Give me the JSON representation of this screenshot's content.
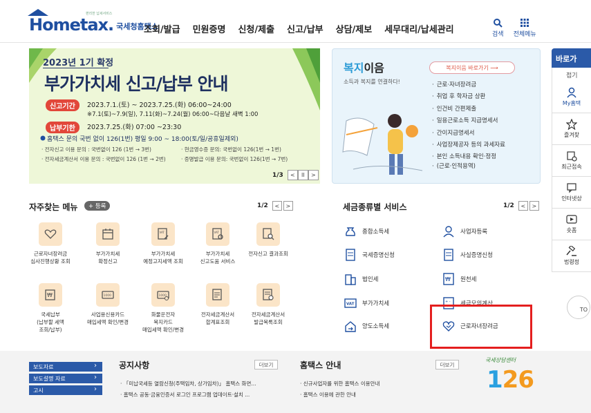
{
  "header": {
    "logo_main": "Hometax.",
    "logo_sub": "국세청홈택스",
    "logo_tiny": "편리한 납세서비스",
    "gnb": [
      "조회/발급",
      "민원증명",
      "신청/제출",
      "신고/납부",
      "상담/제보",
      "세무대리/납세관리"
    ],
    "search_label": "검색",
    "allmenu_label": "전체메뉴"
  },
  "banner": {
    "year": "2023년 1기 확정",
    "title": "부가가치세 신고/납부 안내",
    "period_label": "신고기간",
    "period_text": "2023.7.1.(토) ~ 2023.7.25.(화) 06:00~24:00",
    "period_note": "※7.1(토)~7.9(일), 7.11(화)~7.24(월) 06:00~다음날 새벽 1:00",
    "due_label": "납부기한",
    "due_text": "2023.7.25.(화) 07:00 ~23:30",
    "contact": "홈택스 문의 국번 없이 126(1번) 평일 9:00 ~ 18:00(토/일/공휴일제외)",
    "s1": "· 전자신고 이용 문의 : 국번없이 126 (1번 → 3번)",
    "s2": "· 현금영수증 문의: 국번없이 126(1번 → 1번)",
    "s3": "· 전자세금계산서 이용 문의 : 국번없이 126 (1번 → 2번)",
    "s4": "· 증명발급 이용 문의: 국번없이 126(1번 → 7번)",
    "page": "1/3",
    "prev": "<",
    "pause": "II",
    "next": ">"
  },
  "welfare": {
    "title_a": "복지",
    "title_b": "이음",
    "subtitle": "소득과 복지를 연결하다!",
    "button": "복지이음 바로가기",
    "items": [
      "근로·자녀장려금",
      "취업 후 학자금 상환",
      "인건비 간편제출",
      "일용근로소득 지급명세서",
      "간이지급명세서",
      "사업장제공자 등의 과세자료",
      "본인 소득내용 확인·정정",
      "(근로·인적용역)"
    ]
  },
  "quick": {
    "head": "바로가",
    "fold": "접기",
    "items": [
      "My홈택",
      "즐겨찾",
      "최근접속",
      "인터넷상",
      "숏폼",
      "법령정"
    ],
    "top": "TO"
  },
  "freq": {
    "title": "자주찾는 메뉴",
    "reg": "+ 등록",
    "page": "1/2",
    "prev": "<",
    "next": ">",
    "items": [
      "근로자녀장려금\n심사진행상황 조회",
      "부가가치세\n확정신고",
      "부가가치세\n예정고지세액 조회",
      "부가가치세\n신고도움 서비스",
      "전자신고 결과조회",
      "국세납부\n(납부할 세액\n조회/납부)",
      "사업용신용카드\n매입세액 확인/변경",
      "화물운전자\n복지카드\n매입세액 확인/변경",
      "전자세금계산서\n합계표조회",
      "전자세금계산서\n발급목록조회"
    ]
  },
  "tax": {
    "title": "세금종류별 서비스",
    "page": "1/2",
    "prev": "<",
    "next": ">",
    "items": [
      "종합소득세",
      "사업자등록",
      "국세증명신청",
      "사실증명신청",
      "법인세",
      "원천세",
      "부가가치세",
      "세금모의계산",
      "양도소득세",
      "근로자녀장려금"
    ]
  },
  "bottom": {
    "side": [
      "보도자료",
      "보도설명 자료",
      "고시"
    ],
    "notice_title": "공지사항",
    "notice_more": "더보기",
    "notice_lines": [
      "「미납국세등 열람신청(주택임차, 상가임차)」 홈택스 화면...",
      "홈택스 공동·금융인증서 로그인 프로그램 업데이트·설치 ..."
    ],
    "guide_title": "홈택스 안내",
    "guide_more": "더보기",
    "guide_lines": [
      "신규사업자를 위한 홈택스 이용안내",
      "홈택스 이용에 관한 안내"
    ],
    "call_label": "국세상담센터",
    "call_number": "126"
  },
  "colors": {
    "brand": "#1f4fa0",
    "accent_red": "#e41e1e",
    "banner_bg": "#eef7d8"
  }
}
